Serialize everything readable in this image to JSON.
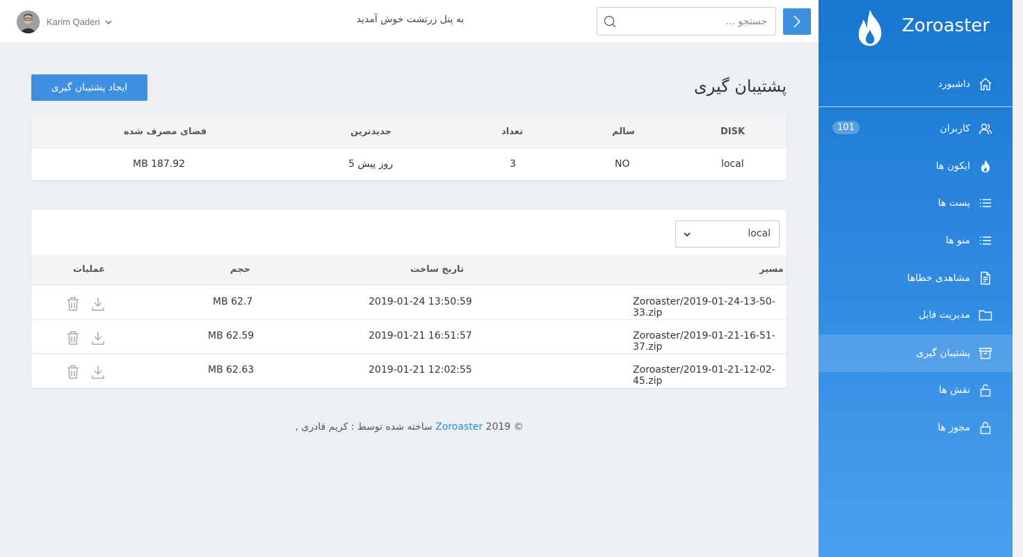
{
  "header": {
    "user_name": "Karim Qaderi",
    "welcome": "به پنل زرتشت خوش آمدید",
    "search_placeholder": "جستجو ..."
  },
  "sidebar": {
    "brand": "Zoroaster",
    "items": [
      {
        "label": "داشبورد",
        "icon": "home-icon"
      },
      {
        "label": "کاربران",
        "icon": "users-icon",
        "badge": "101"
      },
      {
        "label": "ایکون ها",
        "icon": "flame-icon"
      },
      {
        "label": "پست ها",
        "icon": "list-icon"
      },
      {
        "label": "منو ها",
        "icon": "list-icon"
      },
      {
        "label": "مشاهدی خطاها",
        "icon": "file-icon"
      },
      {
        "label": "مدیریت فایل",
        "icon": "folder-icon"
      },
      {
        "label": "پشتیبان گیری",
        "icon": "archive-icon",
        "active": true
      },
      {
        "label": "نقش ها",
        "icon": "unlock-icon"
      },
      {
        "label": "مجوز ها",
        "icon": "lock-icon"
      }
    ]
  },
  "page": {
    "title": "پشتیبان گیری",
    "create_button": "ایجاد پشتیبان گیری"
  },
  "disk_table": {
    "headers": {
      "disk": "DISK",
      "healthy": "سالم",
      "count": "تعداد",
      "newest": "جدیدترین",
      "used": "فضای مصرف شده"
    },
    "row": {
      "disk": "local",
      "healthy": "NO",
      "count": "3",
      "newest": "5 روز پیش",
      "used": "MB 187.92"
    }
  },
  "backups": {
    "selected_disk": "local",
    "headers": {
      "path": "مسیر",
      "date": "تاریخ ساخت",
      "size": "حجم",
      "ops": "عملیات"
    },
    "rows": [
      {
        "path": "Zoroaster/2019-01-24-13-50-33.zip",
        "date": "2019-01-24 13:50:59",
        "size": "MB 62.7"
      },
      {
        "path": "Zoroaster/2019-01-21-16-51-37.zip",
        "date": "2019-01-21 16:51:57",
        "size": "MB 62.59"
      },
      {
        "path": "Zoroaster/2019-01-21-12-02-45.zip",
        "date": "2019-01-21 12:02:55",
        "size": "MB 62.63"
      }
    ]
  },
  "footer": {
    "year": "2019 ©",
    "brand": "Zoroaster",
    "credit": ", ساخته شده توسط : کریم قادری"
  },
  "colors": {
    "accent": "#3d8fe0",
    "sidebar_top": "#1877d0",
    "sidebar_bottom": "#4aa0ee",
    "link": "#2b8ad8"
  }
}
